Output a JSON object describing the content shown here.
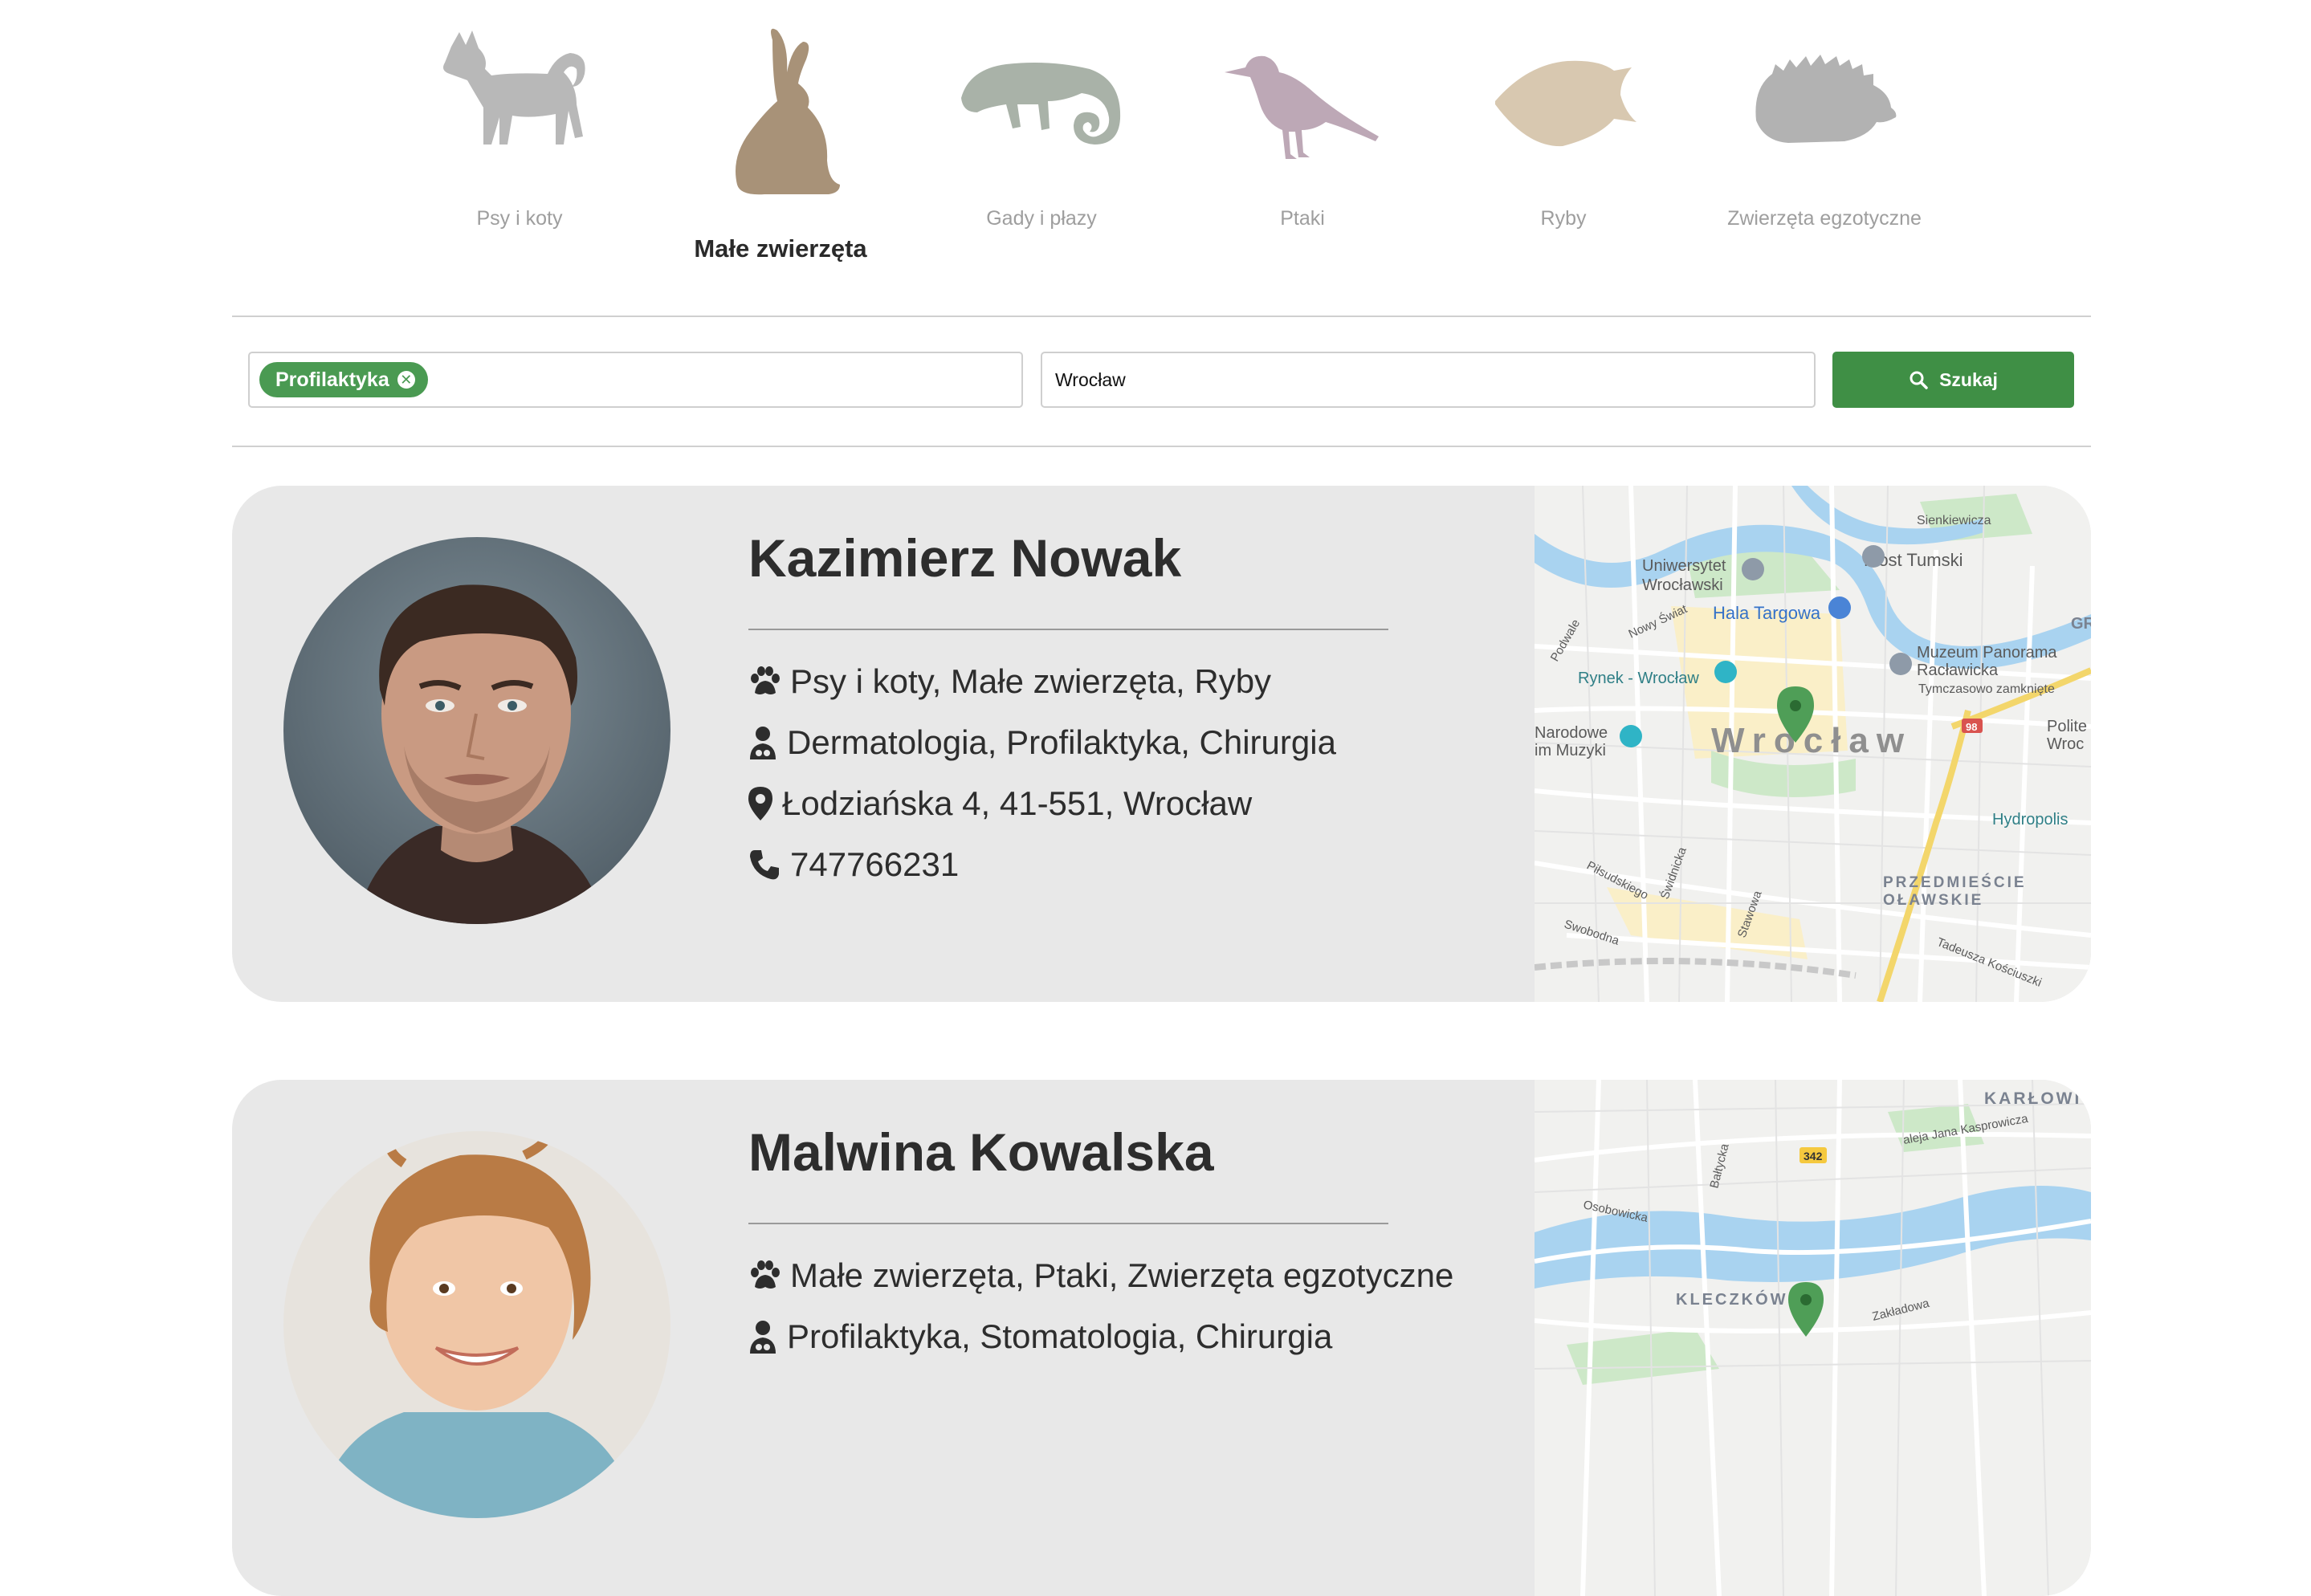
{
  "categories": [
    {
      "label": "Psy i koty",
      "icon": "dog-silhouette-icon",
      "active": false
    },
    {
      "label": "Małe zwierzęta",
      "icon": "rabbit-silhouette-icon",
      "active": true
    },
    {
      "label": "Gady i płazy",
      "icon": "chameleon-silhouette-icon",
      "active": false
    },
    {
      "label": "Ptaki",
      "icon": "bird-silhouette-icon",
      "active": false
    },
    {
      "label": "Ryby",
      "icon": "fish-silhouette-icon",
      "active": false
    },
    {
      "label": "Zwierzęta egzotyczne",
      "icon": "hedgehog-silhouette-icon",
      "active": false
    }
  ],
  "search": {
    "tag": "Profilaktyka",
    "city_value": "Wrocław",
    "button_label": "Szukaj"
  },
  "colors": {
    "accent_green": "#3f8f45",
    "card_bg": "#e8e8e8",
    "active_icon": "#a89278",
    "inactive_icon": "#b8b8b8"
  },
  "vets": [
    {
      "name": "Kazimierz Nowak",
      "animals": "Psy i koty, Małe zwierzęta, Ryby",
      "specialties": "Dermatologia, Profilaktyka, Chirurgia",
      "address": "Łodziańska 4, 41-551, Wrocław",
      "phone": "747766231",
      "map": {
        "city_label": "Wrocław",
        "labels": [
          "Uniwersytet",
          "Wrocławski",
          "Hala Targowa",
          "Most Tumski",
          "Muzeum Panorama",
          "Racławicka",
          "Tymczasowo zamknięte",
          "Rynek - Wrocław",
          "Narodowe",
          "im Muzyki",
          "Polite",
          "Wroc",
          "Hydropolis",
          "PRZEDMIEŚCIE",
          "OŁAWSKIE",
          "Sienkiewicza",
          "Nowy Świat",
          "Podwale",
          "Piłsudskiego",
          "Świdnicka",
          "Stawowa",
          "Swobodna",
          "Tadeusza Kościuszki",
          "GR",
          "98"
        ]
      }
    },
    {
      "name": "Malwina Kowalska",
      "animals": "Małe zwierzęta, Ptaki, Zwierzęta egzotyczne",
      "specialties": "Profilaktyka, Stomatologia, Chirurgia",
      "address": "",
      "phone": "",
      "map": {
        "labels": [
          "KARŁOWI",
          "aleja Jana Kasprowicza",
          "342",
          "Osobowicka",
          "Bałtycka",
          "KLECZKÓW",
          "Zakładowa"
        ]
      }
    }
  ]
}
